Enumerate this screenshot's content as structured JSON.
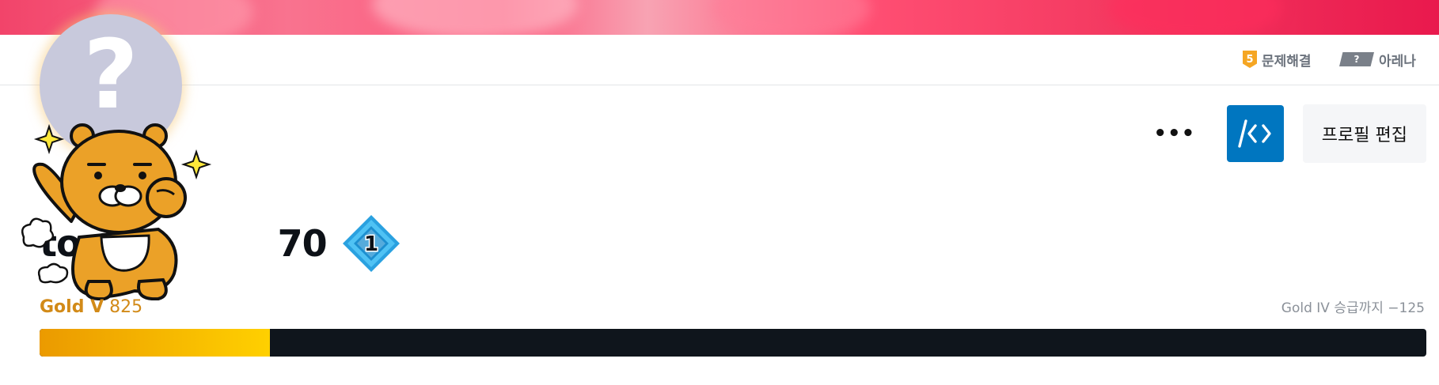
{
  "nav": {
    "problem_solving": {
      "label": "문제해결",
      "badge": "5"
    },
    "arena": {
      "label": "아레나",
      "badge": "?"
    }
  },
  "avatar": {
    "glyph": "?",
    "icon": "question-mark-icon"
  },
  "actions": {
    "more_label": "•••",
    "code_icon": "/<>",
    "edit_label": "프로필 편집"
  },
  "user": {
    "name_left": "to",
    "name_right": "70",
    "class_badge": "1"
  },
  "rating": {
    "tier": "Gold V",
    "value": "825",
    "next": "Gold IV 승급까지 −125",
    "progress": 0.166
  },
  "colors": {
    "brand_blue": "#0076c0",
    "gold": "#d28a18",
    "bar_bg": "#0f151c"
  }
}
